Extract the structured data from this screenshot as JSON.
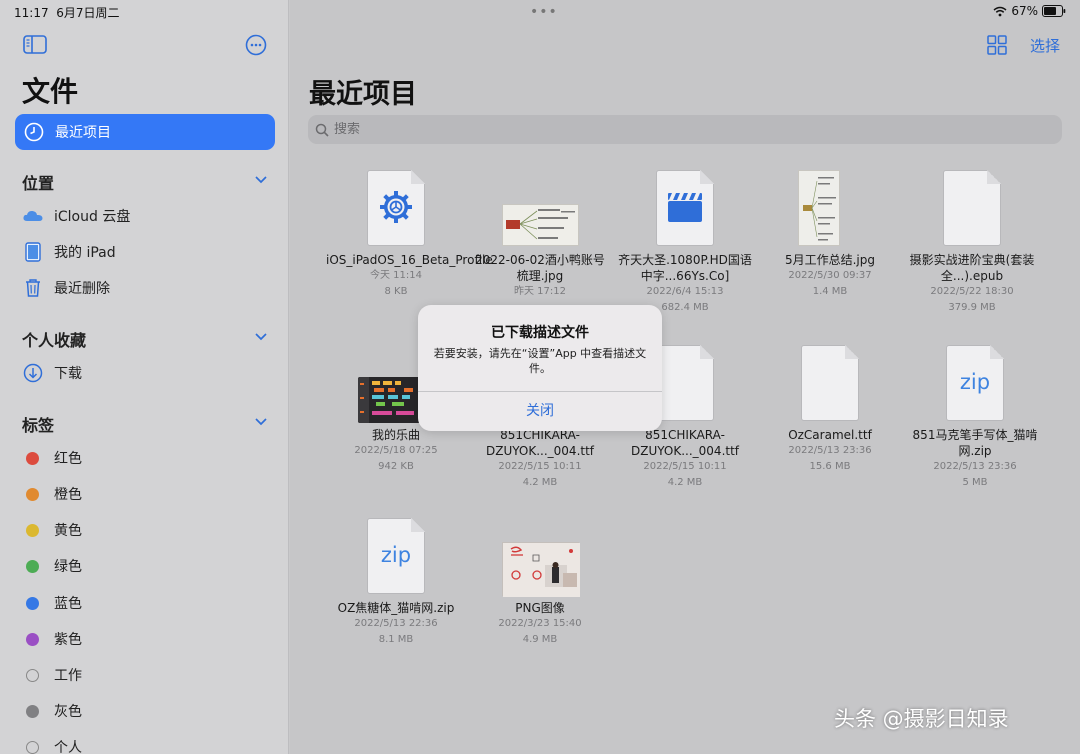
{
  "status": {
    "time": "11:17",
    "date": "6月7日周二",
    "battery": "67%"
  },
  "sidebar": {
    "title": "文件",
    "recent": "最近项目",
    "locations": {
      "heading": "位置",
      "items": [
        {
          "label": "iCloud 云盘",
          "icon": "icloud-icon"
        },
        {
          "label": "我的 iPad",
          "icon": "ipad-icon"
        },
        {
          "label": "最近删除",
          "icon": "trash-icon"
        }
      ]
    },
    "favorites": {
      "heading": "个人收藏",
      "items": [
        {
          "label": "下载",
          "icon": "download-icon"
        }
      ]
    },
    "tags": {
      "heading": "标签",
      "items": [
        {
          "label": "红色",
          "color": "#dc4b3e"
        },
        {
          "label": "橙色",
          "color": "#e08a30"
        },
        {
          "label": "黄色",
          "color": "#dbb830"
        },
        {
          "label": "绿色",
          "color": "#4dac55"
        },
        {
          "label": "蓝色",
          "color": "#3578e5"
        },
        {
          "label": "紫色",
          "color": "#9a4fc4"
        },
        {
          "label": "工作",
          "color": ""
        },
        {
          "label": "灰色",
          "color": "#808083"
        },
        {
          "label": "个人",
          "color": ""
        }
      ]
    }
  },
  "main": {
    "title": "最近项目",
    "select": "选择",
    "search_placeholder": "搜索",
    "files": [
      {
        "name": "iOS_iPadOS_16_Beta_Profile",
        "date": "今天 11:14",
        "size": "8 KB",
        "kind": "profile"
      },
      {
        "name": "2022-06-02酒小鸭账号梳理.jpg",
        "date": "昨天 17:12",
        "size": "",
        "kind": "mindmap"
      },
      {
        "name": "齐天大圣.1080P.HD国语中字...66Ys.Co]",
        "date": "2022/6/4 15:13",
        "size": "682.4 MB",
        "kind": "video"
      },
      {
        "name": "5月工作总结.jpg",
        "date": "2022/5/30 09:37",
        "size": "1.4 MB",
        "kind": "mindmap-tall"
      },
      {
        "name": "摄影实战进阶宝典(套装全...).epub",
        "date": "2022/5/22 18:30",
        "size": "379.9 MB",
        "kind": "doc"
      },
      {
        "name": "我的乐曲",
        "date": "2022/5/18 07:25",
        "size": "942 KB",
        "kind": "music"
      },
      {
        "name": "851CHIKARA-DZUYOK..._004.ttf",
        "date": "2022/5/15 10:11",
        "size": "4.2 MB",
        "kind": "doc"
      },
      {
        "name": "851CHIKARA-DZUYOK..._004.ttf",
        "date": "2022/5/15 10:11",
        "size": "4.2 MB",
        "kind": "doc"
      },
      {
        "name": "OzCaramel.ttf",
        "date": "2022/5/13 23:36",
        "size": "15.6 MB",
        "kind": "doc"
      },
      {
        "name": "851马克笔手写体_猫啃网.zip",
        "date": "2022/5/13 23:36",
        "size": "5 MB",
        "kind": "zip"
      },
      {
        "name": "OZ焦糖体_猫啃网.zip",
        "date": "2022/5/13 22:36",
        "size": "8.1 MB",
        "kind": "zip"
      },
      {
        "name": "PNG图像",
        "date": "2022/3/23 15:40",
        "size": "4.9 MB",
        "kind": "photo"
      }
    ],
    "zip_label": "zip"
  },
  "dialog": {
    "title": "已下载描述文件",
    "message": "若要安装，请先在“设置”App 中查看描述文件。",
    "button": "关闭"
  },
  "watermark": "头条 @摄影日知录",
  "accent": "#3478f6"
}
